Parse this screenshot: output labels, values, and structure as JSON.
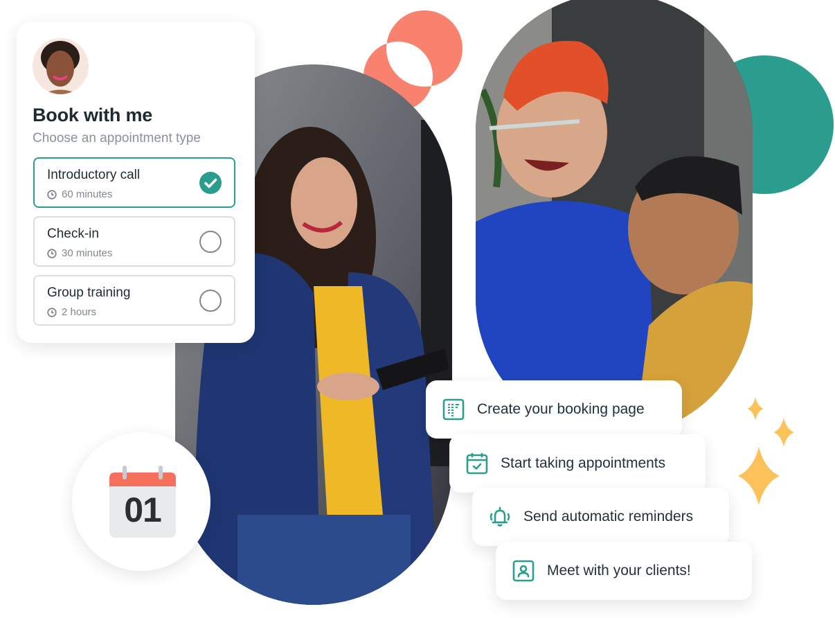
{
  "booking_card": {
    "avatar_alt": "profile photo",
    "title": "Book with me",
    "subtitle": "Choose an appointment type",
    "options": [
      {
        "title": "Introductory call",
        "duration": "60 minutes",
        "selected": true
      },
      {
        "title": "Check-in",
        "duration": "30 minutes",
        "selected": false
      },
      {
        "title": "Group training",
        "duration": "2 hours",
        "selected": false
      }
    ]
  },
  "calendar_badge": {
    "day": "01"
  },
  "steps": [
    {
      "label": "Create your booking page",
      "icon": "booking-page-icon"
    },
    {
      "label": "Start taking appointments",
      "icon": "calendar-check-icon"
    },
    {
      "label": "Send automatic reminders",
      "icon": "bell-icon"
    },
    {
      "label": "Meet with your clients!",
      "icon": "client-icon"
    }
  ],
  "colors": {
    "accent_teal": "#2a9d8f",
    "coral": "#f8826d",
    "sparkle_yellow": "#fcc25a",
    "text_dark": "#1f2a30",
    "text_muted": "#8a9296"
  }
}
